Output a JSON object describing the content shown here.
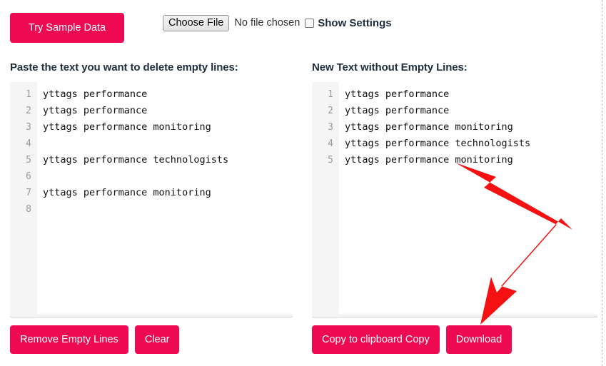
{
  "toolbar": {
    "sample_button": "Try Sample Data",
    "choose_file_button": "Choose File",
    "no_file_text": "No file chosen",
    "show_settings_label": "Show Settings",
    "show_settings_checked": false
  },
  "left_panel": {
    "heading": "Paste the text you want to delete empty lines:",
    "line_numbers": [
      "1",
      "2",
      "3",
      "4",
      "5",
      "6",
      "7",
      "8"
    ],
    "lines": [
      "yttags performance",
      "yttags performance",
      "yttags performance monitoring",
      "",
      "yttags performance technologists",
      "",
      "yttags performance monitoring",
      ""
    ],
    "buttons": [
      "Remove Empty Lines",
      "Clear"
    ]
  },
  "right_panel": {
    "heading": "New Text without Empty Lines:",
    "line_numbers": [
      "1",
      "2",
      "3",
      "4",
      "5"
    ],
    "lines": [
      "yttags performance",
      "yttags performance",
      "yttags performance monitoring",
      "yttags performance technologists",
      "yttags performance monitoring"
    ],
    "buttons": [
      "Copy to clipboard Copy",
      "Download"
    ]
  },
  "annotation": {
    "arrow_color": "#F51111",
    "type": "double-headed-bent-arrow"
  },
  "colors": {
    "brand_pink": "#ED0A53",
    "heading": "#1f2d3d",
    "gutter_bg": "#f5f5f5",
    "line_number": "#9a9a9a"
  }
}
